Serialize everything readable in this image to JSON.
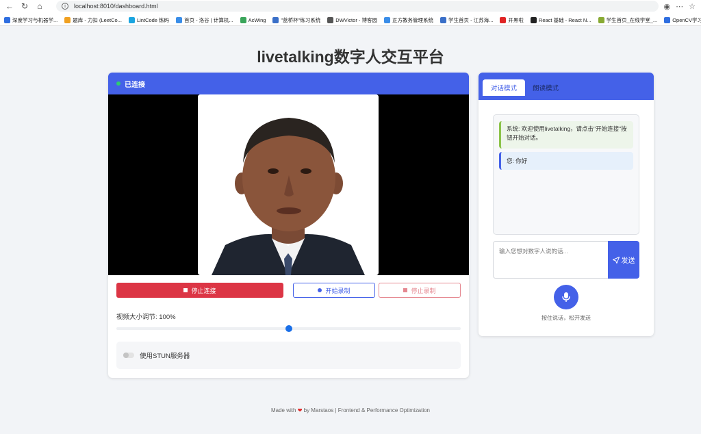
{
  "browser": {
    "url": "localhost:8010/dashboard.html",
    "bookmarks": [
      {
        "label": "深度学习与机器学...",
        "color": "#2f6ee0"
      },
      {
        "label": "题库 - 力扣 (LeetCo...",
        "color": "#f0a020"
      },
      {
        "label": "LintCode 炼码",
        "color": "#1ba5e0"
      },
      {
        "label": "首页 - 洛谷 | 计算机...",
        "color": "#3a8de8"
      },
      {
        "label": "AcWing",
        "color": "#3aa55a"
      },
      {
        "label": "\"蓝桥杯\"练习系统",
        "color": "#3a6fc8"
      },
      {
        "label": "DWVictor - 博客园",
        "color": "#555555"
      },
      {
        "label": "正方教务管理系统",
        "color": "#3a8de8"
      },
      {
        "label": "学生首页 - 江苏海...",
        "color": "#3a6fc8"
      },
      {
        "label": "开黑啦",
        "color": "#e02424"
      },
      {
        "label": "React 基础 - React N...",
        "color": "#222222"
      },
      {
        "label": "学生首页_在线学堂_...",
        "color": "#88aa33"
      },
      {
        "label": "OpenCV学习笔记 (...",
        "color": "#2f6ee0"
      }
    ]
  },
  "page": {
    "title": "livetalking数字人交互平台"
  },
  "left": {
    "status": "已连接",
    "stop_connect": "停止连接",
    "start_record": "开始录制",
    "stop_record": "停止录制",
    "video_size_label": "视频大小调节: 100%",
    "video_size_fraction": 0.5,
    "stun_label": "使用STUN服务器"
  },
  "right": {
    "tabs": [
      "对话模式",
      "朗读模式"
    ],
    "messages": {
      "system": "系统: 欢迎使用livetalking，请点击\"开始连接\"按钮开始对话。",
      "user": "您: 你好"
    },
    "input_placeholder": "输入您想对数字人说的话...",
    "send_label": "发送",
    "mic_hint": "按住说话，松开发送"
  },
  "footer": {
    "made_with": "Made with",
    "by": "by Marstaos | Frontend & Performance Optimization"
  },
  "colors": {
    "primary": "#4461e8",
    "danger": "#dc3545",
    "connected": "#2ecc71"
  }
}
